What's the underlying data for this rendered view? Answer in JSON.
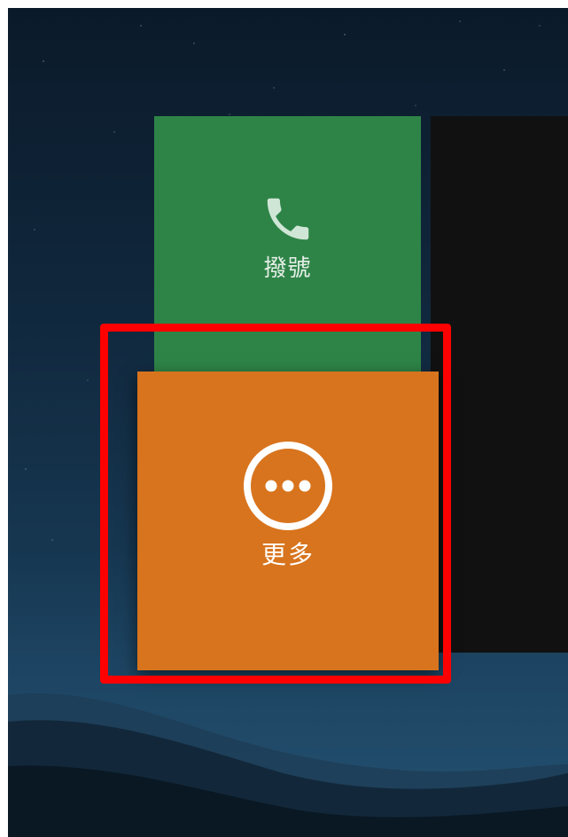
{
  "tiles": {
    "dial": {
      "label": "撥號",
      "icon": "phone-icon",
      "color": "#2e8447"
    },
    "more": {
      "label": "更多",
      "icon": "more-circle-icon",
      "color": "#d8741d"
    }
  },
  "highlight": {
    "color": "#ff0000"
  }
}
